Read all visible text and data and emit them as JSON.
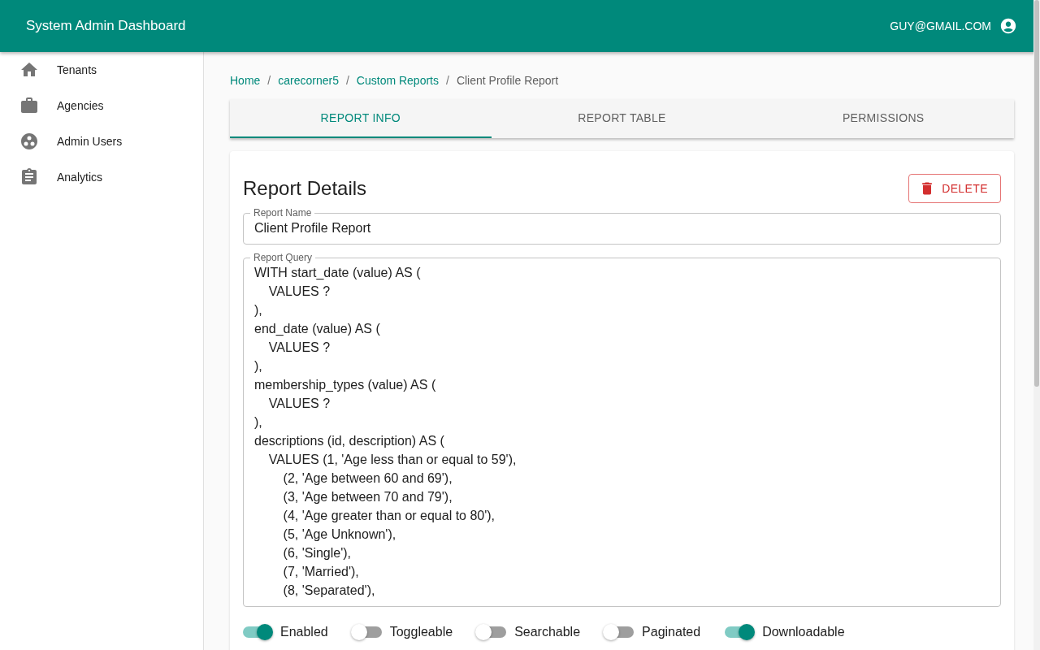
{
  "app_bar": {
    "title": "System Admin Dashboard",
    "user": "GUY@GMAIL.COM"
  },
  "sidebar": {
    "items": [
      {
        "kind": "home",
        "label": "Tenants"
      },
      {
        "kind": "briefcase",
        "label": "Agencies"
      },
      {
        "kind": "users",
        "label": "Admin Users"
      },
      {
        "kind": "clipboard",
        "label": "Analytics"
      }
    ]
  },
  "breadcrumbs": [
    {
      "label": "Home",
      "link": true
    },
    {
      "label": "carecorner5",
      "link": true
    },
    {
      "label": "Custom Reports",
      "link": true
    },
    {
      "label": "Client Profile Report",
      "link": false
    }
  ],
  "breadcrumb_separator": "/",
  "tabs": [
    {
      "label": "REPORT INFO",
      "selected": true
    },
    {
      "label": "REPORT TABLE",
      "selected": false
    },
    {
      "label": "PERMISSIONS",
      "selected": false
    }
  ],
  "report": {
    "title": "Report Details",
    "delete_button": "DELETE",
    "name_field": {
      "label": "Report Name",
      "value": "Client Profile Report"
    },
    "query_field": {
      "label": "Report Query",
      "lines": [
        "WITH start_date (value) AS (",
        "    VALUES ?",
        "),",
        "end_date (value) AS (",
        "    VALUES ?",
        "),",
        "membership_types (value) AS (",
        "    VALUES ?",
        "),",
        "descriptions (id, description) AS (",
        "    VALUES (1, 'Age less than or equal to 59'),",
        "        (2, 'Age between 60 and 69'),",
        "        (3, 'Age between 70 and 79'),",
        "        (4, 'Age greater than or equal to 80'),",
        "        (5, 'Age Unknown'),",
        "        (6, 'Single'),",
        "        (7, 'Married'),",
        "        (8, 'Separated'),"
      ]
    },
    "toggles": [
      {
        "label": "Enabled",
        "on": true
      },
      {
        "label": "Toggleable",
        "on": false
      },
      {
        "label": "Searchable",
        "on": false
      },
      {
        "label": "Paginated",
        "on": false
      },
      {
        "label": "Downloadable",
        "on": true
      }
    ]
  }
}
